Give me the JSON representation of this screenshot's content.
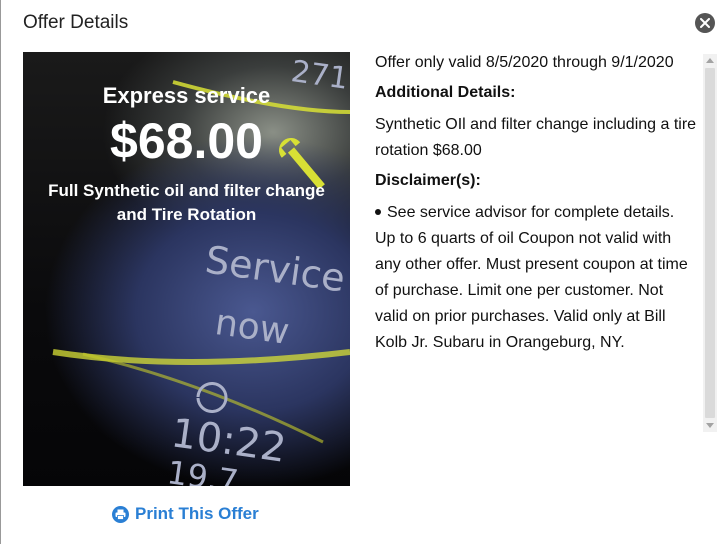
{
  "modal": {
    "title": "Offer Details",
    "close_icon": "close-icon"
  },
  "promo": {
    "title": "Express service",
    "price": "$68.00",
    "description": "Full Synthetic oil and filter change and Tire Rotation",
    "dash_speed": "271",
    "dash_service": "Service",
    "dash_now": "now",
    "dash_time": "10:22",
    "dash_temp": "19.7"
  },
  "print": {
    "label": "Print This Offer",
    "icon": "printer-icon"
  },
  "details": {
    "validity": "Offer only valid 8/5/2020 through 9/1/2020",
    "additional_heading": "Additional Details:",
    "additional_text": "Synthetic OIl and filter change including a tire rotation $68.00",
    "disclaimer_heading": "Disclaimer(s):",
    "disclaimer_text": "See service advisor for complete details. Up to 6 quarts of oil Coupon not valid with any other offer. Must present coupon at time of purchase. Limit one per customer. Not valid on prior purchases. Valid only at Bill Kolb Jr. Subaru in Orangeburg, NY."
  },
  "colors": {
    "link": "#2a7fd4",
    "close_bg": "#555555",
    "accent_yellow": "#d8e035"
  }
}
